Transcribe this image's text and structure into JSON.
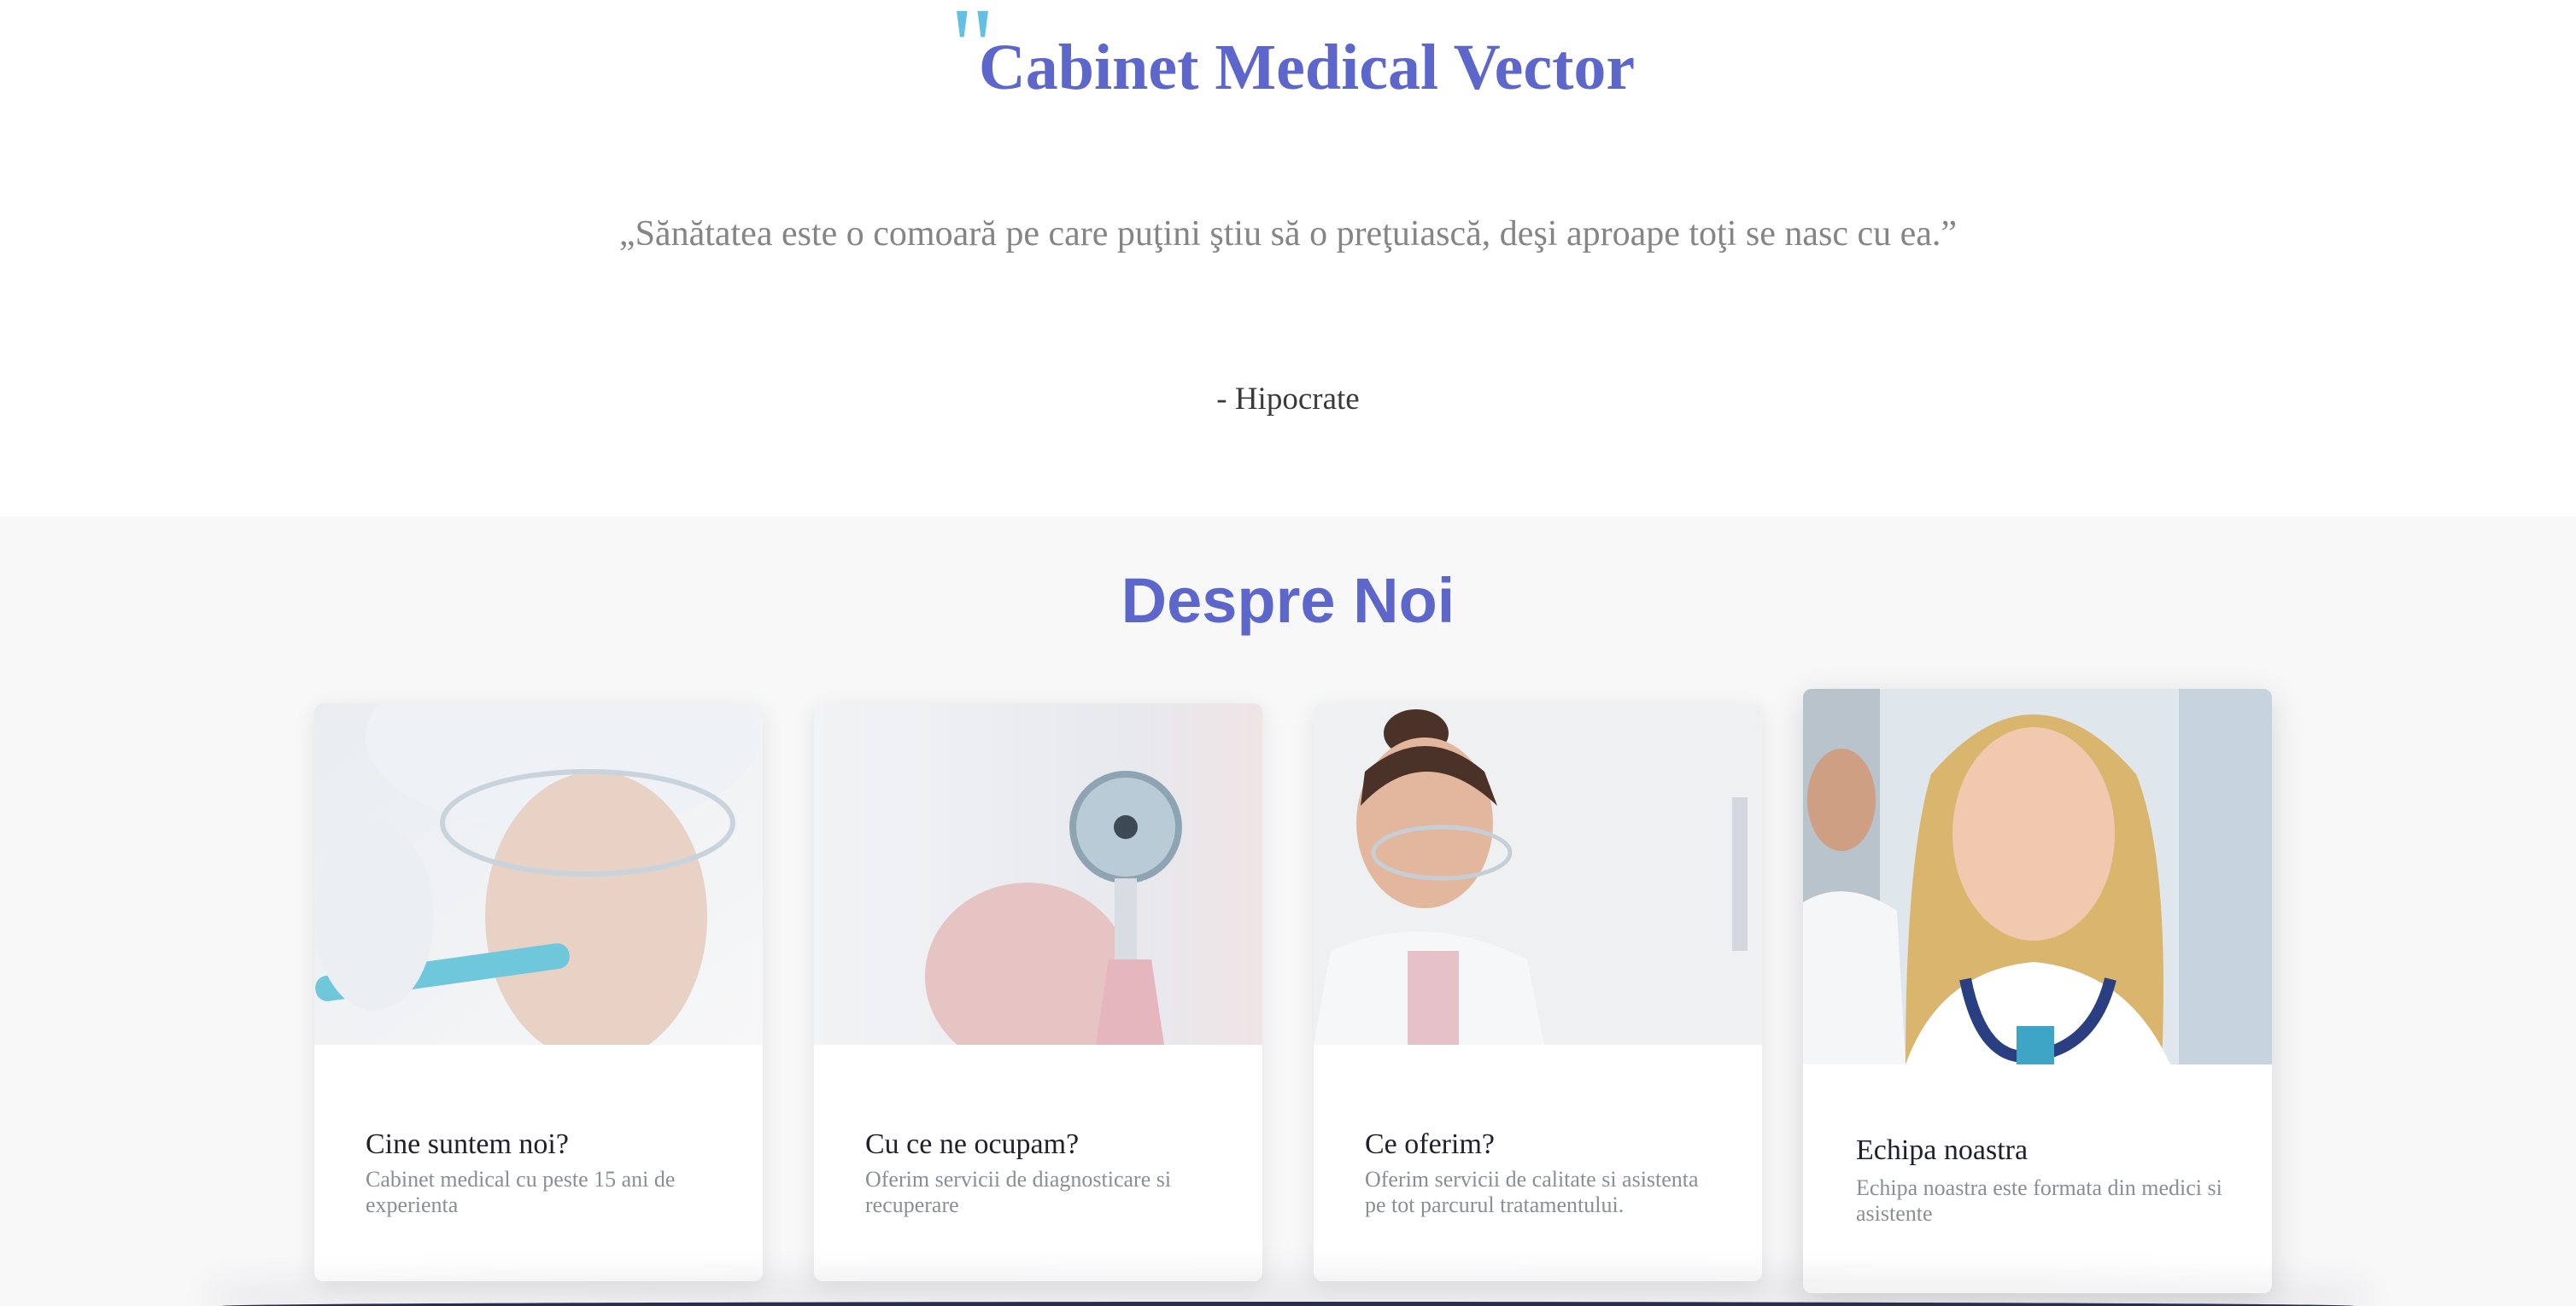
{
  "hero": {
    "quote_mark": "\"",
    "title": "Cabinet Medical Vector",
    "quote": "„Sănătatea este o comoară pe care puţini ştiu să o preţuiască, deşi aproape toţi se nasc cu ea.”",
    "author": "- Hipocrate"
  },
  "about": {
    "title": "Despre Noi",
    "cards": [
      {
        "image": "lab-technician-test-tube-photo",
        "title": "Cine suntem noi?",
        "description": "Cabinet medical cu peste 15 ani de experienta"
      },
      {
        "image": "hand-holding-stethoscope-photo",
        "title": "Cu ce ne ocupam?",
        "description": "Oferim servicii de diagnosticare si recuperare"
      },
      {
        "image": "scientist-with-goggles-photo",
        "title": "Ce oferim?",
        "description": "Oferim servicii de calitate si asistenta pe tot parcurul tratamentului."
      },
      {
        "image": "smiling-doctor-photo",
        "title": "Echipa noastra",
        "description": "Echipa noastra este formata din medici si asistente"
      }
    ]
  },
  "colors": {
    "accent": "#5d67cb",
    "quote_mark": "#62c0e4",
    "section_bg": "#f8f8f9"
  }
}
